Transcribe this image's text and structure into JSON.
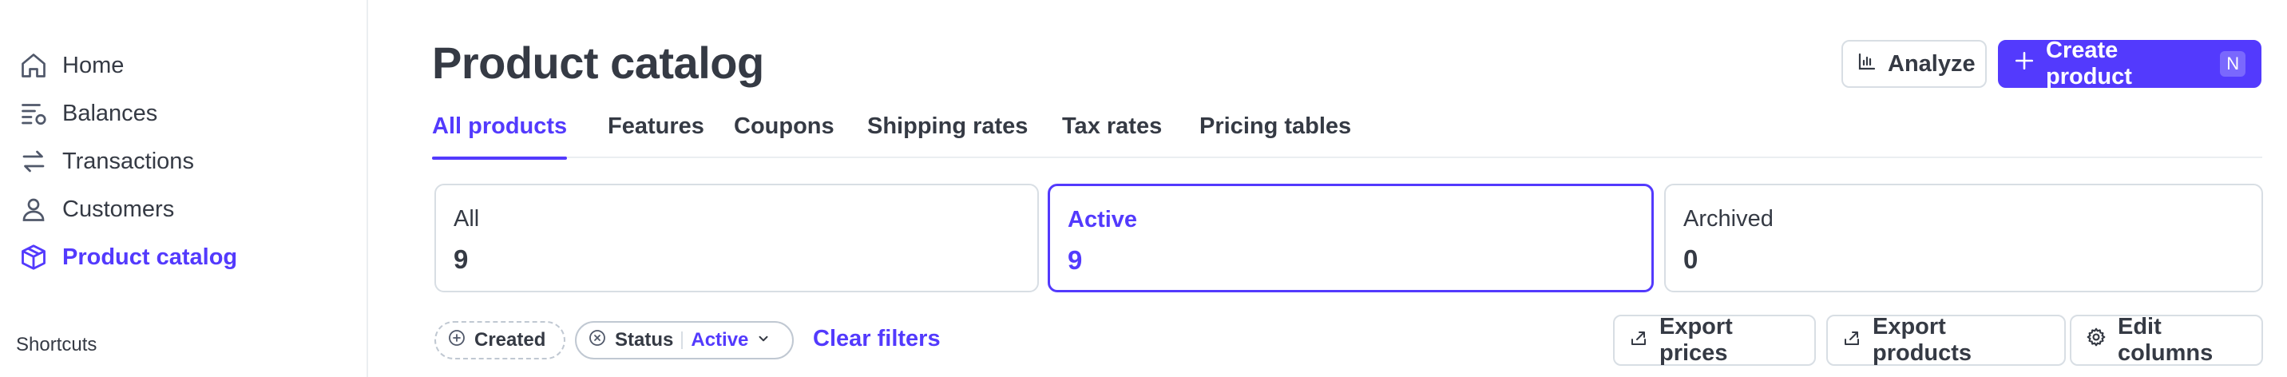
{
  "sidebar": {
    "items": [
      {
        "label": "Home",
        "icon": "home-icon"
      },
      {
        "label": "Balances",
        "icon": "balances-icon"
      },
      {
        "label": "Transactions",
        "icon": "arrows-swap-icon"
      },
      {
        "label": "Customers",
        "icon": "person-icon"
      },
      {
        "label": "Product catalog",
        "icon": "package-icon",
        "active": true
      }
    ],
    "shortcuts_heading": "Shortcuts"
  },
  "header": {
    "title": "Product catalog",
    "analyze_label": "Analyze",
    "create_label": "Create product",
    "create_shortcut": "N"
  },
  "tabs": [
    {
      "label": "All products",
      "active": true
    },
    {
      "label": "Features"
    },
    {
      "label": "Coupons"
    },
    {
      "label": "Shipping rates"
    },
    {
      "label": "Tax rates"
    },
    {
      "label": "Pricing tables"
    }
  ],
  "stats": [
    {
      "label": "All",
      "value": "9"
    },
    {
      "label": "Active",
      "value": "9",
      "active": true
    },
    {
      "label": "Archived",
      "value": "0"
    }
  ],
  "filters": {
    "created_label": "Created",
    "status_label": "Status",
    "status_value": "Active",
    "clear_label": "Clear filters"
  },
  "actions": {
    "export_prices": "Export prices",
    "export_products": "Export products",
    "edit_columns": "Edit columns"
  },
  "colors": {
    "accent": "#533afd",
    "text": "#353a44",
    "border": "#d8dee4"
  }
}
